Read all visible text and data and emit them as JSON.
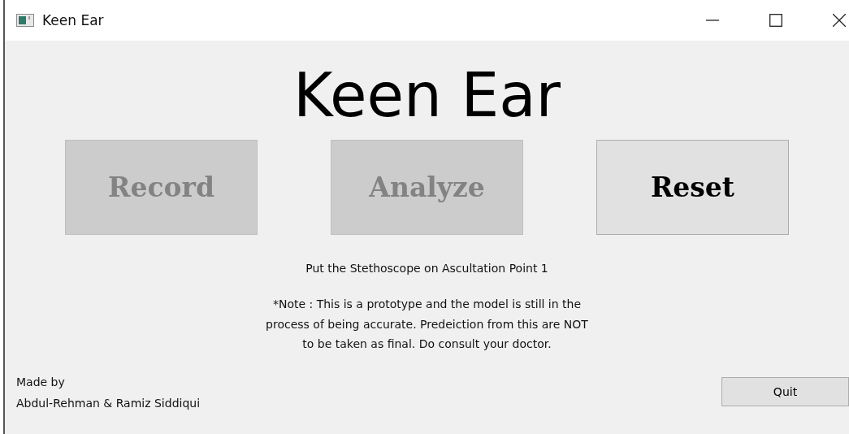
{
  "window": {
    "title": "Keen Ear"
  },
  "heading": "Keen Ear",
  "buttons": [
    {
      "label": "Record",
      "disabled": true
    },
    {
      "label": "Analyze",
      "disabled": true
    },
    {
      "label": "Reset",
      "disabled": false
    }
  ],
  "instruction": "Put the Stethoscope on Ascultation Point 1",
  "note": [
    "*Note : This is a prototype and the model is still in the",
    "process of being accurate. Predeiction from this are NOT",
    "to be taken as final. Do consult your doctor."
  ],
  "credits": [
    "Made by",
    "Abdul-Rehman & Ramiz Siddiqui"
  ],
  "quit_button": "Quit"
}
